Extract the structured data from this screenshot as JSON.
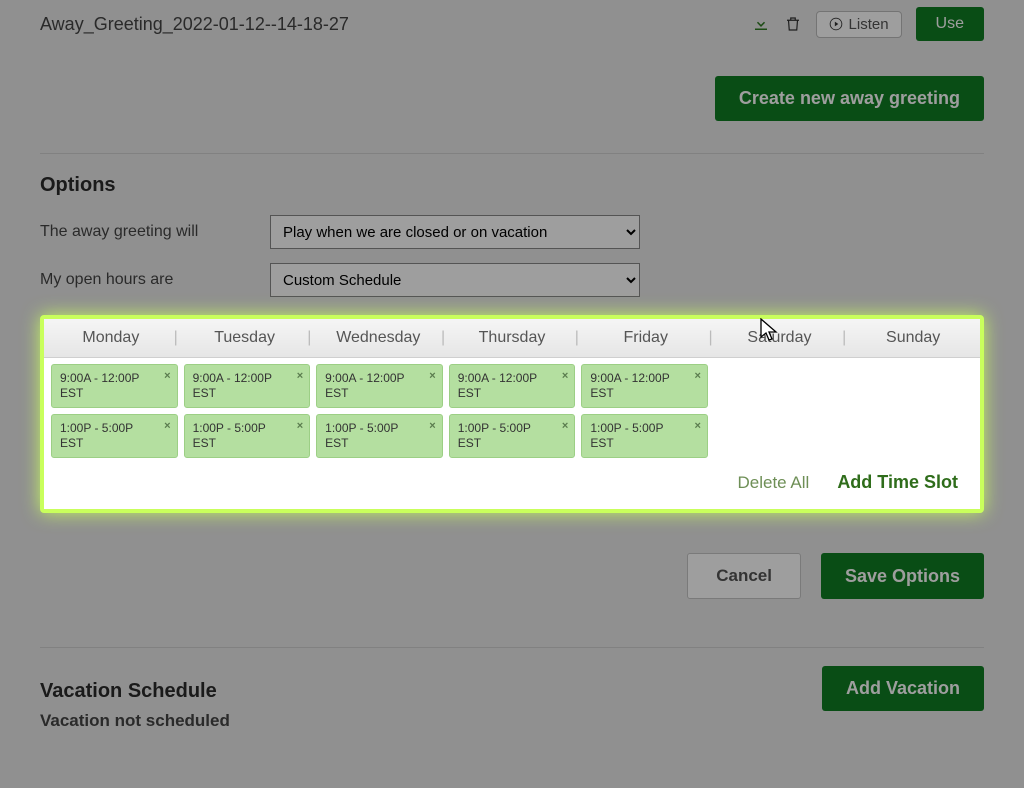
{
  "greeting": {
    "name": "Away_Greeting_2022-01-12--14-18-27",
    "listen_label": "Listen",
    "use_label": "Use"
  },
  "buttons": {
    "create_new": "Create new away greeting",
    "cancel": "Cancel",
    "save_options": "Save Options",
    "add_vacation": "Add Vacation",
    "delete_all": "Delete All",
    "add_time_slot": "Add Time Slot"
  },
  "options": {
    "heading": "Options",
    "row1_label": "The away greeting will",
    "row1_value": "Play when we are closed or on vacation",
    "row2_label": "My open hours are",
    "row2_value": "Custom Schedule"
  },
  "schedule": {
    "days": [
      "Monday",
      "Tuesday",
      "Wednesday",
      "Thursday",
      "Friday",
      "Saturday",
      "Sunday"
    ],
    "timezone": "EST",
    "slots": {
      "Monday": [
        "9:00A - 12:00P",
        "1:00P - 5:00P"
      ],
      "Tuesday": [
        "9:00A - 12:00P",
        "1:00P - 5:00P"
      ],
      "Wednesday": [
        "9:00A - 12:00P",
        "1:00P - 5:00P"
      ],
      "Thursday": [
        "9:00A - 12:00P",
        "1:00P - 5:00P"
      ],
      "Friday": [
        "9:00A - 12:00P",
        "1:00P - 5:00P"
      ],
      "Saturday": [],
      "Sunday": []
    }
  },
  "vacation": {
    "heading": "Vacation Schedule",
    "status": "Vacation not scheduled"
  }
}
